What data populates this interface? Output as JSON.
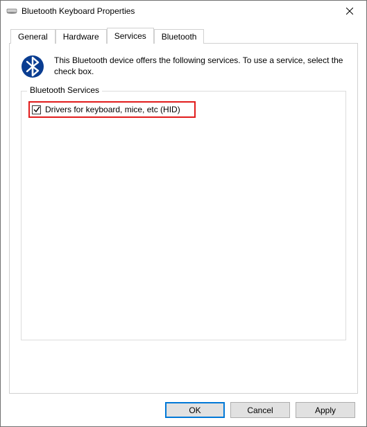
{
  "window": {
    "title": "Bluetooth Keyboard Properties"
  },
  "tabs": {
    "general": "General",
    "hardware": "Hardware",
    "services": "Services",
    "bluetooth": "Bluetooth",
    "active": "services"
  },
  "services_panel": {
    "intro": "This Bluetooth device offers the following services. To use a service, select the check box.",
    "group_label": "Bluetooth Services",
    "items": [
      {
        "label": "Drivers for keyboard, mice, etc (HID)",
        "checked": true
      }
    ]
  },
  "buttons": {
    "ok": "OK",
    "cancel": "Cancel",
    "apply": "Apply"
  }
}
